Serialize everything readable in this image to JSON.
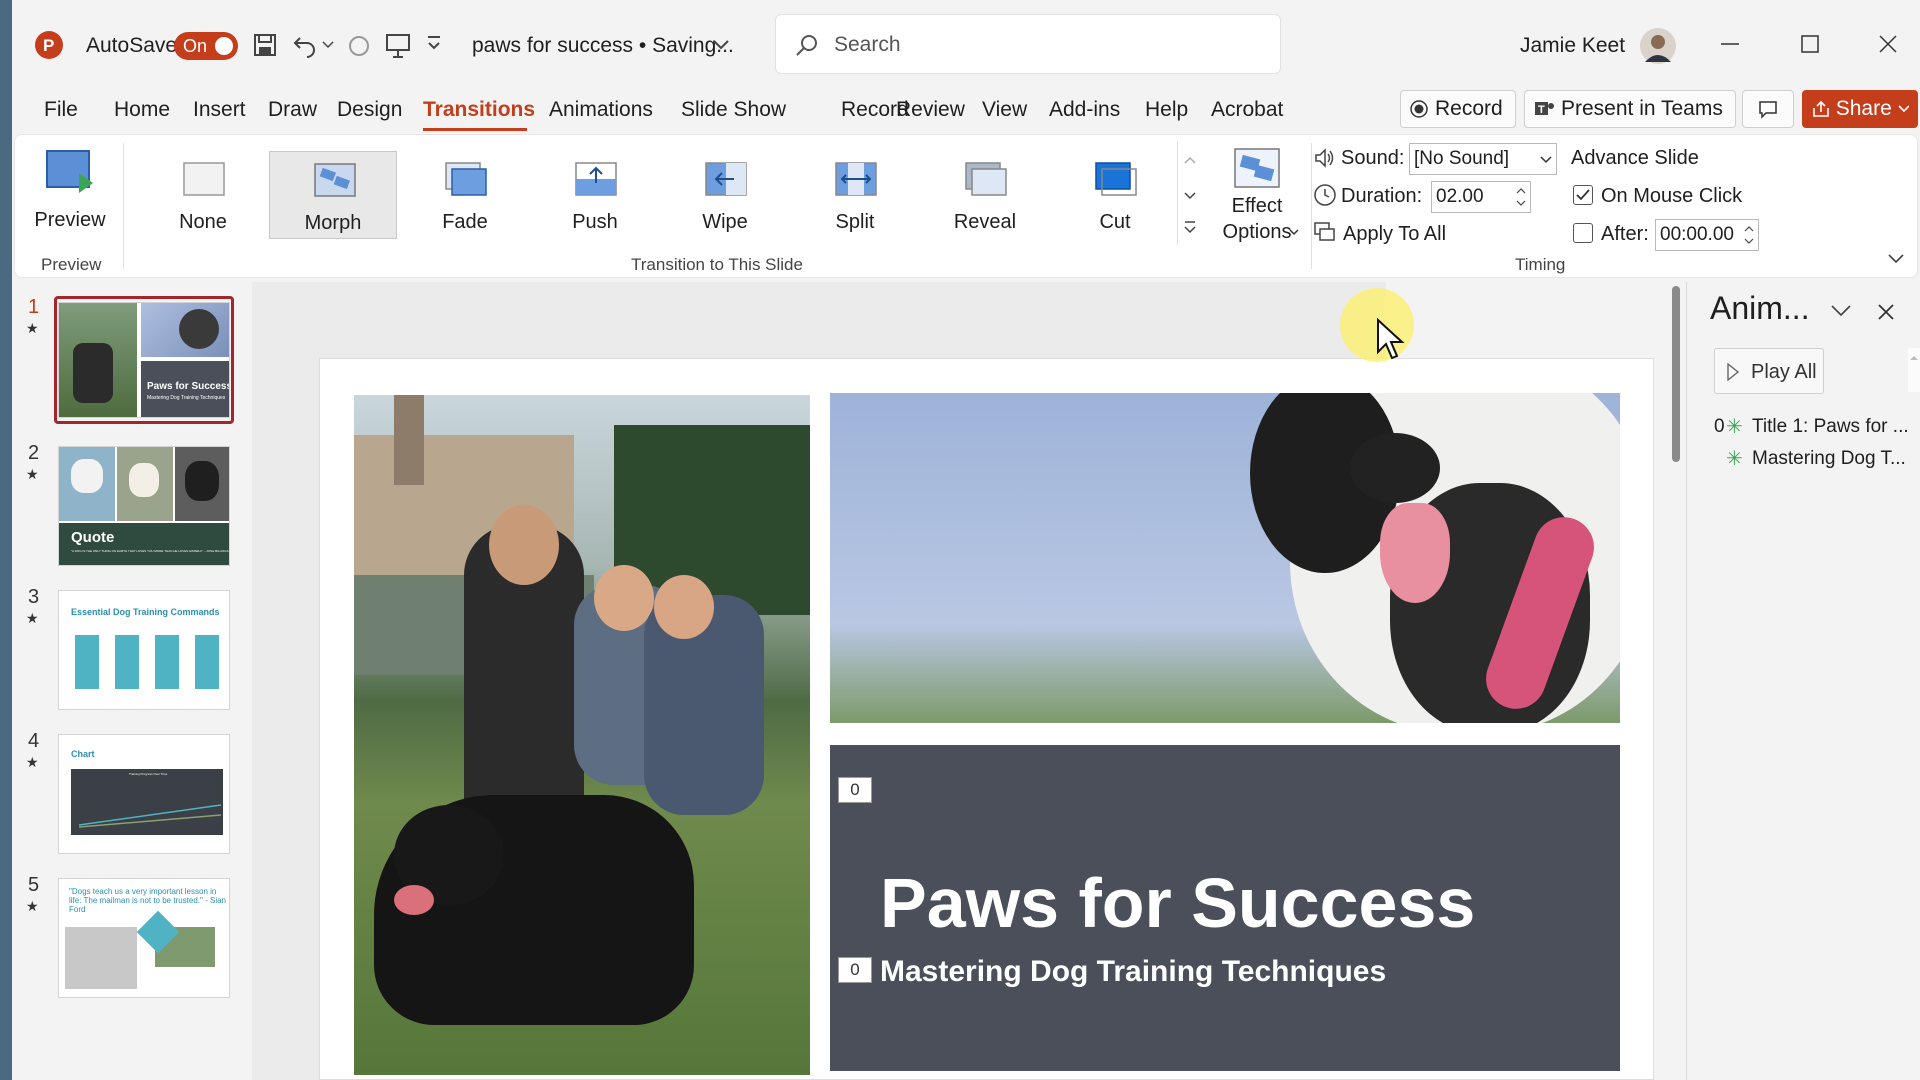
{
  "titlebar": {
    "autosave_label": "AutoSave",
    "autosave_state": "On",
    "doc_title": "paws for success • Saving...",
    "search_placeholder": "Search",
    "user_name": "Jamie Keet"
  },
  "menu": [
    "File",
    "Home",
    "Insert",
    "Draw",
    "Design",
    "Transitions",
    "Animations",
    "Slide Show",
    "Record",
    "Review",
    "View",
    "Add-ins",
    "Help",
    "Acrobat"
  ],
  "menu_active": "Transitions",
  "header_buttons": {
    "record": "Record",
    "present_teams": "Present in Teams",
    "share": "Share"
  },
  "ribbon": {
    "preview_label": "Preview",
    "preview_group": "Preview",
    "transitions": [
      "None",
      "Morph",
      "Fade",
      "Push",
      "Wipe",
      "Split",
      "Reveal",
      "Cut"
    ],
    "selected_transition": "Morph",
    "transition_group": "Transition to This Slide",
    "effect_options_1": "Effect",
    "effect_options_2": "Options",
    "sound_label": "Sound:",
    "sound_value": "[No Sound]",
    "duration_label": "Duration:",
    "duration_value": "02.00",
    "apply_all": "Apply To All",
    "advance_slide": "Advance Slide",
    "on_mouse_click": "On Mouse Click",
    "on_mouse_click_checked": true,
    "after_label": "After:",
    "after_value": "00:00.00",
    "after_checked": false,
    "timing_group": "Timing"
  },
  "slides": [
    {
      "num": "1",
      "title": "Paws for Success",
      "subtitle": "Mastering Dog Training Techniques"
    },
    {
      "num": "2",
      "title": "Quote",
      "subtitle": "\"A DOG IS THE ONLY THING ON EARTH THAT LOVES YOU MORE THAN HE LOVES HIMSELF.\" - JOSH BILLINGS"
    },
    {
      "num": "3",
      "title": "Essential Dog Training Commands"
    },
    {
      "num": "4",
      "title": "Chart",
      "chart_title": "Training Progress Over Time"
    },
    {
      "num": "5",
      "quote": "\"Dogs teach us a very important lesson in life: The mailman is not to be trusted.\" - Sian Ford"
    }
  ],
  "main_slide": {
    "title": "Paws for Success",
    "subtitle": "Mastering Dog Training Techniques",
    "badge_title": "0",
    "badge_subtitle": "0"
  },
  "anim_pane": {
    "title": "Anim...",
    "play_all": "Play All",
    "items": [
      {
        "index": "0",
        "label": "Title 1: Paws for ..."
      },
      {
        "index": "",
        "label": "Mastering Dog T..."
      }
    ]
  },
  "colors": {
    "accent": "#c43e1c",
    "slide_dark": "#4a4f5a",
    "teal": "#4fb3c4"
  }
}
